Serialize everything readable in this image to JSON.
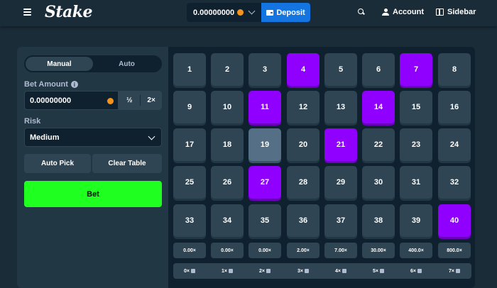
{
  "header": {
    "logo": "Stake",
    "balance": "0.00000000",
    "deposit_label": "Deposit",
    "account_label": "Account",
    "sidebar_label": "Sidebar"
  },
  "controls": {
    "tabs": [
      {
        "label": "Manual",
        "active": true
      },
      {
        "label": "Auto",
        "active": false
      }
    ],
    "bet_amount_label": "Bet Amount",
    "bet_amount_value": "0.00000000",
    "half_label": "½",
    "double_label": "2×",
    "risk_label": "Risk",
    "risk_value": "Medium",
    "auto_pick_label": "Auto Pick",
    "clear_table_label": "Clear Table",
    "bet_label": "Bet"
  },
  "board": {
    "tiles": [
      "1",
      "2",
      "3",
      "4",
      "5",
      "6",
      "7",
      "8",
      "9",
      "10",
      "11",
      "12",
      "13",
      "14",
      "15",
      "16",
      "17",
      "18",
      "19",
      "20",
      "21",
      "22",
      "23",
      "24",
      "25",
      "26",
      "27",
      "28",
      "29",
      "30",
      "31",
      "32",
      "33",
      "34",
      "35",
      "36",
      "37",
      "38",
      "39",
      "40"
    ],
    "selected": [
      4,
      7,
      11,
      14,
      21,
      27,
      40
    ],
    "hovered": [
      19
    ]
  },
  "payouts": [
    "0.00×",
    "0.00×",
    "0.00×",
    "2.00×",
    "7.00×",
    "30.00×",
    "400.0×",
    "800.0×"
  ],
  "hits": [
    "0×",
    "1×",
    "2×",
    "3×",
    "4×",
    "5×",
    "6×",
    "7×"
  ],
  "colors": {
    "accent_green": "#1fff20",
    "selected_purple": "#9000ff",
    "deposit_blue": "#1475e1",
    "bitcoin_orange": "#f7931a"
  },
  "icons": [
    "menu-icon",
    "bitcoin-icon",
    "chevron-down-icon",
    "wallet-icon",
    "search-icon",
    "user-icon",
    "sidebar-icon",
    "info-icon",
    "gem-icon"
  ]
}
